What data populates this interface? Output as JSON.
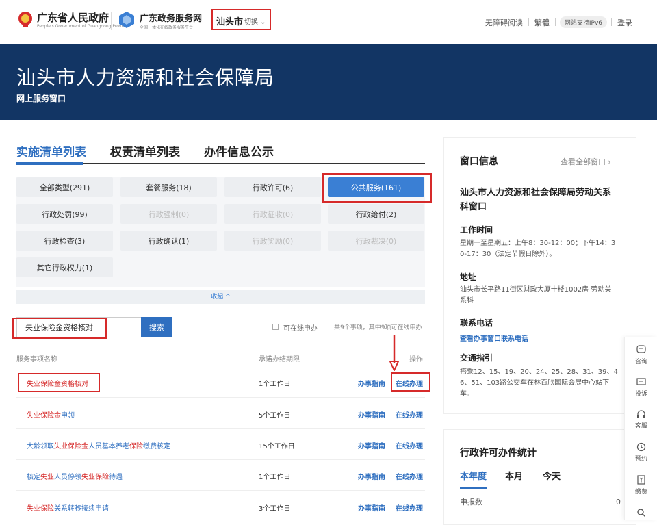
{
  "header": {
    "gov_name": "广东省人民政府",
    "gov_sub": "People's Government of Guangdong Province",
    "portal_name": "广东政务服务网",
    "portal_sub": "全国一体化在线政务服务平台",
    "city": "汕头市",
    "city_switch": "切换",
    "links": [
      "无障碍阅读",
      "繁體",
      "网站支持IPv6",
      "登录"
    ]
  },
  "banner": {
    "title": "汕头市人力资源和社会保障局",
    "subtitle": "网上服务窗口"
  },
  "tabs": [
    "实施清单列表",
    "权责清单列表",
    "办件信息公示"
  ],
  "filters": [
    {
      "label": "全部类型(291)",
      "state": "normal"
    },
    {
      "label": "套餐服务(18)",
      "state": "normal"
    },
    {
      "label": "行政许可(6)",
      "state": "normal"
    },
    {
      "label": "公共服务(161)",
      "state": "active"
    },
    {
      "label": "行政处罚(99)",
      "state": "normal"
    },
    {
      "label": "行政强制(0)",
      "state": "disabled"
    },
    {
      "label": "行政征收(0)",
      "state": "disabled"
    },
    {
      "label": "行政给付(2)",
      "state": "normal"
    },
    {
      "label": "行政检查(3)",
      "state": "normal"
    },
    {
      "label": "行政确认(1)",
      "state": "normal"
    },
    {
      "label": "行政奖励(0)",
      "state": "disabled"
    },
    {
      "label": "行政裁决(0)",
      "state": "disabled"
    },
    {
      "label": "其它行政权力(1)",
      "state": "normal"
    }
  ],
  "collapse_label": "收起 ^",
  "search": {
    "value": "失业保险金资格核对",
    "button": "搜索",
    "online_only": "可在线申办",
    "count": "共9个事项，其中9项可在线申办"
  },
  "table": {
    "headers": [
      "服务事项名称",
      "承诺办结期限",
      "操作"
    ],
    "rows": [
      {
        "name": "失业保险金资格核对",
        "days": "1个工作日",
        "guide": "办事指南",
        "online": "在线办理"
      },
      {
        "name_parts": [
          [
            "失业保险金",
            "r"
          ],
          [
            "申领",
            "b"
          ]
        ],
        "days": "5个工作日",
        "guide": "办事指南",
        "online": "在线办理"
      },
      {
        "name_parts": [
          [
            "大龄领取",
            "b"
          ],
          [
            "失业保险金",
            "r"
          ],
          [
            "人员基本养老",
            "b"
          ],
          [
            "保险",
            "r"
          ],
          [
            "缴费核定",
            "b"
          ]
        ],
        "days": "15个工作日",
        "guide": "办事指南",
        "online": "在线办理"
      },
      {
        "name_parts": [
          [
            "核定",
            "b"
          ],
          [
            "失业",
            "r"
          ],
          [
            "人员停领",
            "b"
          ],
          [
            "失业保险",
            "r"
          ],
          [
            "待遇",
            "b"
          ]
        ],
        "days": "1个工作日",
        "guide": "办事指南",
        "online": "在线办理"
      },
      {
        "name_parts": [
          [
            "失业保险",
            "r"
          ],
          [
            "关系转移接续申请",
            "b"
          ]
        ],
        "days": "3个工作日",
        "guide": "办事指南",
        "online": "在线办理"
      }
    ]
  },
  "window_info": {
    "title": "窗口信息",
    "view_all": "查看全部窗口 ›",
    "name_line1": "汕头市人力资源和社会保障局劳动关系",
    "name_line2": "科窗口",
    "hours_label": "工作时间",
    "hours_line1": "星期一至星期五：上午8：30-12：00；下午14：3",
    "hours_line2": "0-17：30（法定节假日除外）。",
    "address_label": "地址",
    "address_line1": "汕头市长平路11街区财政大厦十楼1002房 劳动关",
    "address_line2": "系科",
    "phone_label": "联系电话",
    "phone_link": "查看办事窗口联系电话",
    "traffic_label": "交通指引",
    "traffic_line1": "搭乘12、15、19、20、24、25、28、31、39、4",
    "traffic_line2": "6、51、103路公交车在林百欣国际会展中心站下",
    "traffic_line3": "车。"
  },
  "stats": {
    "title": "行政许可办件统计",
    "periods": [
      "本年度",
      "本月",
      "今天"
    ],
    "row_label": "申报数",
    "row_value": "0"
  },
  "float_bar": [
    "咨询",
    "投诉",
    "客服",
    "预约",
    "缴费"
  ]
}
